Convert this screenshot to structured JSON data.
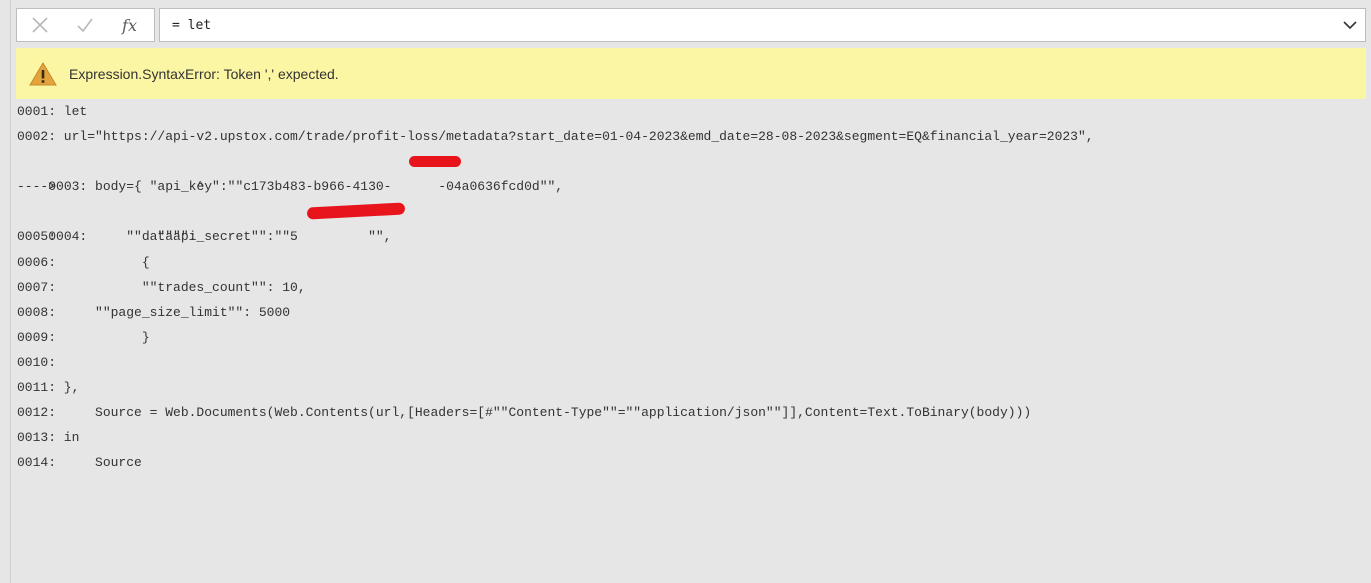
{
  "formula_bar": {
    "cancel_icon": "close-icon",
    "commit_icon": "check-icon",
    "fx_label": "fx",
    "formula_text": "= let",
    "expand_icon": "chevron-down-icon"
  },
  "error": {
    "icon": "warning-icon",
    "message": "Expression.SyntaxError: Token ',' expected."
  },
  "code_lines": [
    "0001: let",
    "0002: url=\"https://api-v2.upstox.com/trade/profit-loss/metadata?start_date=01-04-2023&emd_date=28-08-2023&segment=EQ&financial_year=2023\",",
    "0003: body={ \"api_key\":\"\"c173b483-b966-4130-      -04a0636fcd0d\"\",",
    "---->                  ^",
    "0004:         \"\"api_secret\"\":\"\"5         \"\",",
    "0005:         \"\"data\"\":",
    "0006:           {",
    "0007:           \"\"trades_count\"\": 10,",
    "0008:     \"\"page_size_limit\"\": 5000",
    "0009:           }",
    "0010:",
    "0011: },",
    "0012:     Source = Web.Documents(Web.Contents(url,[Headers=[#\"\"Content-Type\"\"=\"\"application/json\"\"]],Content=Text.ToBinary(body)))",
    "0013: in",
    "0014:     Source"
  ]
}
